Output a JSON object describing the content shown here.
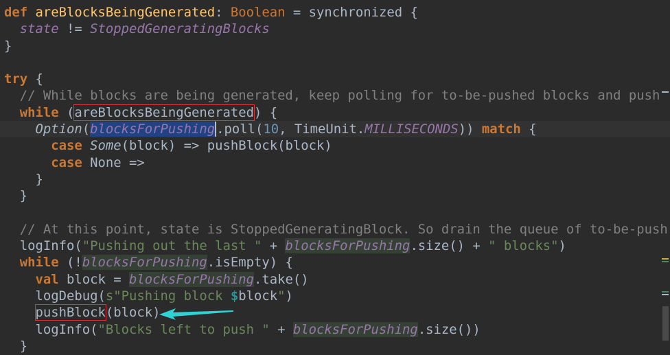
{
  "colors": {
    "background": "#2b2b2b",
    "keyword": "#cc7832",
    "function": "#ffc66d",
    "field": "#9876aa",
    "comment": "#808080",
    "string": "#6a8759",
    "number": "#6897bb",
    "text": "#a9b7c6",
    "annotation_box": "#e0303a",
    "annotation_arrow": "#2fd3d3"
  },
  "current_line": 7,
  "lines": [
    [
      [
        "def",
        "k"
      ],
      [
        " ",
        ""
      ],
      [
        "areBlocksBeingGenerated",
        "f"
      ],
      [
        ": ",
        ""
      ],
      [
        "Boolean",
        "kt"
      ],
      [
        " = synchronized {",
        ""
      ]
    ],
    [
      [
        "  ",
        ""
      ],
      [
        "state",
        "p"
      ],
      [
        " != ",
        ""
      ],
      [
        "StoppedGeneratingBlocks",
        "p"
      ]
    ],
    [
      [
        "}",
        ""
      ]
    ],
    [],
    [
      [
        "try",
        "k"
      ],
      [
        " {",
        ""
      ]
    ],
    [
      [
        "  ",
        ""
      ],
      [
        "// While blocks are being generated, keep polling for to-be-pushed blocks and push",
        "c"
      ]
    ],
    [
      [
        "  ",
        ""
      ],
      [
        "while",
        "k"
      ],
      [
        " (",
        ""
      ],
      [
        "areBlocksBeingGenerated",
        "box"
      ],
      [
        ") {",
        ""
      ]
    ],
    [
      [
        "    ",
        ""
      ],
      [
        "Option",
        "i"
      ],
      [
        "(",
        ""
      ],
      [
        "blocksForPushing",
        "sel"
      ],
      [
        ".poll(",
        ""
      ],
      [
        "10",
        "n"
      ],
      [
        ", TimeUnit.",
        ""
      ],
      [
        "MILLISECONDS",
        "p"
      ],
      [
        ")) ",
        ""
      ],
      [
        "match",
        "k"
      ],
      [
        " {",
        ""
      ]
    ],
    [
      [
        "      ",
        ""
      ],
      [
        "case",
        "k"
      ],
      [
        " ",
        ""
      ],
      [
        "Some",
        "i"
      ],
      [
        "(block) => pushBlock(block)",
        ""
      ]
    ],
    [
      [
        "      ",
        ""
      ],
      [
        "case",
        "k"
      ],
      [
        " None =>",
        ""
      ]
    ],
    [
      [
        "    }",
        ""
      ]
    ],
    [
      [
        "  }",
        ""
      ]
    ],
    [],
    [
      [
        "  ",
        ""
      ],
      [
        "// At this point, state is StoppedGeneratingBlock. So drain the queue of to-be-push",
        "c"
      ]
    ],
    [
      [
        "  logInfo(",
        ""
      ],
      [
        "\"Pushing out the last \"",
        "s"
      ],
      [
        " + ",
        ""
      ],
      [
        "blocksForPushing",
        "occ"
      ],
      [
        ".size() + ",
        ""
      ],
      [
        "\" blocks\"",
        "s"
      ],
      [
        ")",
        ""
      ]
    ],
    [
      [
        "  ",
        ""
      ],
      [
        "while",
        "k"
      ],
      [
        " (!",
        ""
      ],
      [
        "blocksForPushing",
        "occ"
      ],
      [
        ".isEmpty) {",
        ""
      ]
    ],
    [
      [
        "    ",
        ""
      ],
      [
        "val",
        "k"
      ],
      [
        " block = ",
        ""
      ],
      [
        "blocksForPushing",
        "occ"
      ],
      [
        ".take()",
        ""
      ]
    ],
    [
      [
        "    logDebug(",
        ""
      ],
      [
        "s\"Pushing block ",
        "s"
      ],
      [
        "$",
        "d"
      ],
      [
        "block",
        ""
      ],
      [
        "\"",
        "s"
      ],
      [
        ")",
        ""
      ]
    ],
    [
      [
        "    ",
        ""
      ],
      [
        "pushBlock",
        "box"
      ],
      [
        "(block)",
        ""
      ]
    ],
    [
      [
        "    logInfo(",
        ""
      ],
      [
        "\"Blocks left to push \"",
        "s"
      ],
      [
        " + ",
        ""
      ],
      [
        "blocksForPushing",
        "occ"
      ],
      [
        ".size())",
        ""
      ]
    ],
    [
      [
        "  }",
        ""
      ]
    ]
  ],
  "gutter_marks": [
    {
      "line": 5,
      "color": "#a9b7c6"
    },
    {
      "line": 15,
      "color": "#c8b040"
    },
    {
      "line": 15,
      "color": "#4a8a5a"
    },
    {
      "line": 17,
      "color": "#4a8a5a"
    },
    {
      "line": 17,
      "color": "#a9b7c6"
    }
  ]
}
